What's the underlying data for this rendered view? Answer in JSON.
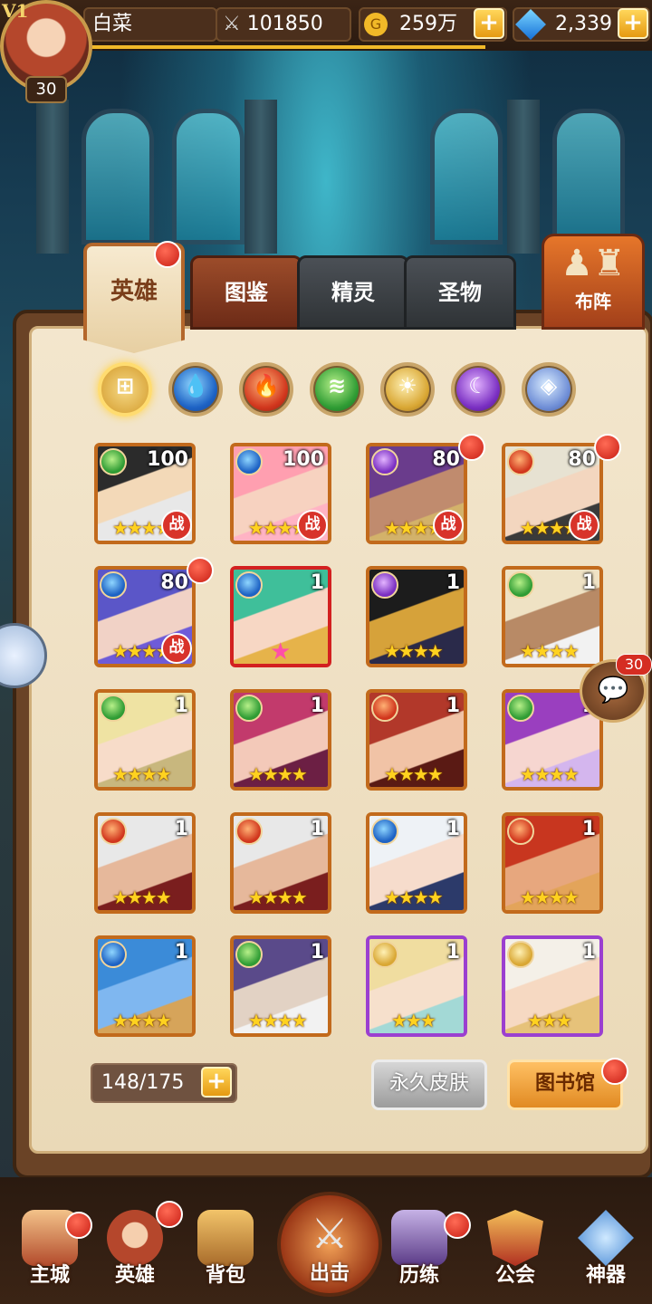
{
  "header": {
    "vip": "V1",
    "level": "30",
    "player_name": "白菜",
    "power": "101850",
    "gold": "259万",
    "gems": "2,339"
  },
  "tabs": {
    "hero": "英雄",
    "codex": "图鉴",
    "spirit": "精灵",
    "relic": "圣物",
    "formation": "布阵"
  },
  "element_filters": [
    "all-icon",
    "water-icon",
    "fire-icon",
    "wind-icon",
    "light-icon",
    "dark-icon",
    "void-icon"
  ],
  "heroes": [
    {
      "element": "wind",
      "level": "100",
      "stars": "★★★★★",
      "battle": "战",
      "frame": "orange",
      "dot": false
    },
    {
      "element": "water",
      "level": "100",
      "stars": "★★★★★",
      "battle": "战",
      "frame": "orange",
      "dot": false
    },
    {
      "element": "dark",
      "level": "80",
      "stars": "★★★★★",
      "battle": "战",
      "frame": "orange",
      "dot": true
    },
    {
      "element": "fire",
      "level": "80",
      "stars": "★★★★★",
      "battle": "战",
      "frame": "orange",
      "dot": true
    },
    {
      "element": "water",
      "level": "80",
      "stars": "★★★★★",
      "battle": "战",
      "frame": "orange",
      "dot": true
    },
    {
      "element": "water",
      "level": "1",
      "stars": "",
      "battle": "",
      "frame": "red",
      "dot": false
    },
    {
      "element": "dark",
      "level": "1",
      "stars": "★★★★",
      "battle": "",
      "frame": "orange",
      "dot": false
    },
    {
      "element": "wind",
      "level": "1",
      "stars": "★★★★",
      "battle": "",
      "frame": "orange",
      "dot": false
    },
    {
      "element": "wind",
      "level": "1",
      "stars": "★★★★",
      "battle": "",
      "frame": "orange",
      "dot": false
    },
    {
      "element": "wind",
      "level": "1",
      "stars": "★★★★",
      "battle": "",
      "frame": "orange",
      "dot": false
    },
    {
      "element": "fire",
      "level": "1",
      "stars": "★★★★",
      "battle": "",
      "frame": "orange",
      "dot": false
    },
    {
      "element": "wind",
      "level": "1",
      "stars": "★★★★",
      "battle": "",
      "frame": "orange",
      "dot": false
    },
    {
      "element": "fire",
      "level": "1",
      "stars": "★★★★",
      "battle": "",
      "frame": "orange",
      "dot": false
    },
    {
      "element": "fire",
      "level": "1",
      "stars": "★★★★",
      "battle": "",
      "frame": "orange",
      "dot": false
    },
    {
      "element": "water",
      "level": "1",
      "stars": "★★★★",
      "battle": "",
      "frame": "orange",
      "dot": false
    },
    {
      "element": "fire",
      "level": "1",
      "stars": "★★★★",
      "battle": "",
      "frame": "orange",
      "dot": false
    },
    {
      "element": "water",
      "level": "1",
      "stars": "★★★★",
      "battle": "",
      "frame": "orange",
      "dot": false
    },
    {
      "element": "wind",
      "level": "1",
      "stars": "★★★★",
      "battle": "",
      "frame": "orange",
      "dot": false
    },
    {
      "element": "light",
      "level": "1",
      "stars": "★★★",
      "battle": "",
      "frame": "purple",
      "dot": false
    },
    {
      "element": "light",
      "level": "1",
      "stars": "★★★",
      "battle": "",
      "frame": "purple",
      "dot": false
    }
  ],
  "hero_count": "148/175",
  "buttons": {
    "permanent_skin": "永久皮肤",
    "library": "图书馆"
  },
  "chat_badge": "30",
  "bottom_nav": [
    "主城",
    "英雄",
    "背包",
    "出击",
    "历练",
    "公会",
    "神器"
  ],
  "colors": {
    "accent_orange": "#e18a22",
    "notification_red": "#c81e14",
    "gold_plus": "#ffd65a"
  }
}
